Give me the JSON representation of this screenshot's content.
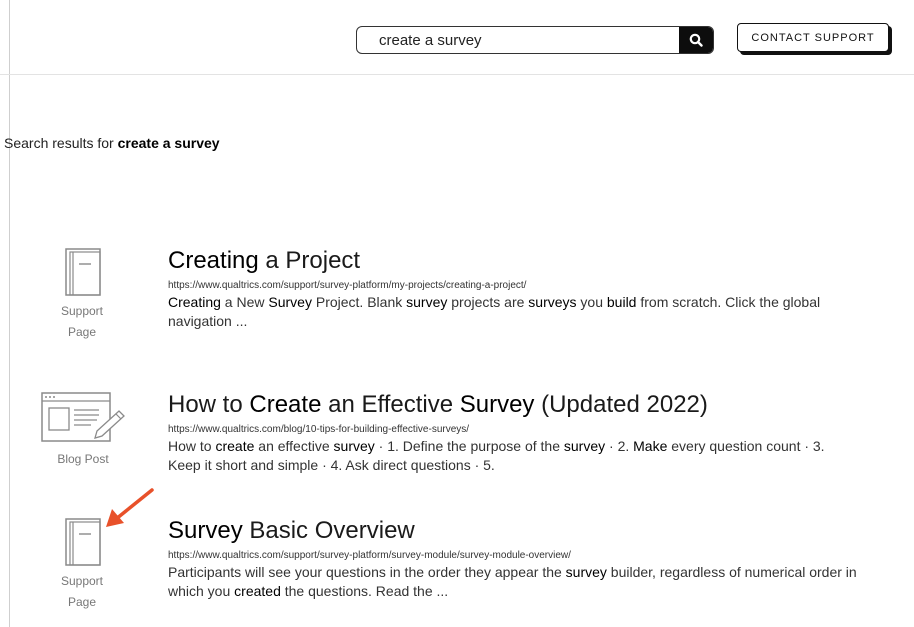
{
  "search": {
    "value": "create a survey",
    "button_icon": "search-icon"
  },
  "header": {
    "contact_label": "CONTACT SUPPORT"
  },
  "results_heading": {
    "prefix": "Search results for ",
    "query": "create a survey"
  },
  "results": [
    {
      "icon": "support-page-icon",
      "type_label_line1": "Support",
      "type_label_line2": "Page",
      "title": {
        "hl": "Creating",
        "rest": " a Project"
      },
      "url": "https://www.qualtrics.com/support/survey-platform/my-projects/creating-a-project/",
      "snippet": [
        {
          "hl": "Creating"
        },
        {
          "t": " a New "
        },
        {
          "hl": "Survey"
        },
        {
          "t": " Project. Blank "
        },
        {
          "hl": "survey"
        },
        {
          "t": " projects are "
        },
        {
          "hl": "surveys"
        },
        {
          "t": " you "
        },
        {
          "hl": "build"
        },
        {
          "t": " from scratch. Click the global navigation ..."
        }
      ]
    },
    {
      "icon": "blog-post-icon",
      "type_label_line1": "Blog Post",
      "type_label_line2": "",
      "title_parts": [
        {
          "t": "How to "
        },
        {
          "hl": "Create"
        },
        {
          "t": " an Effective "
        },
        {
          "hl": "Survey"
        },
        {
          "t": " (Updated 2022)"
        }
      ],
      "url": "https://www.qualtrics.com/blog/10-tips-for-building-effective-surveys/",
      "snippet": [
        {
          "t": "How to "
        },
        {
          "hl": "create"
        },
        {
          "t": " an effective "
        },
        {
          "hl": "survey"
        },
        {
          "t": " · 1. Define the purpose of the "
        },
        {
          "hl": "survey"
        },
        {
          "t": " · 2. "
        },
        {
          "hl": "Make"
        },
        {
          "t": " every question count · 3. Keep it short and simple · 4. Ask direct questions · 5."
        }
      ]
    },
    {
      "icon": "support-page-icon",
      "type_label_line1": "Support",
      "type_label_line2": "Page",
      "title": {
        "hl": "Survey",
        "rest": " Basic Overview"
      },
      "url": "https://www.qualtrics.com/support/survey-platform/survey-module/survey-module-overview/",
      "snippet": [
        {
          "t": "Participants will see your questions in the order they appear the "
        },
        {
          "hl": "survey"
        },
        {
          "t": " builder, regardless of numerical order in which you "
        },
        {
          "hl": "created"
        },
        {
          "t": " the questions. Read the ..."
        }
      ]
    }
  ],
  "colors": {
    "arrow": "#e8512a",
    "icon_stroke": "#8a8a8a"
  }
}
